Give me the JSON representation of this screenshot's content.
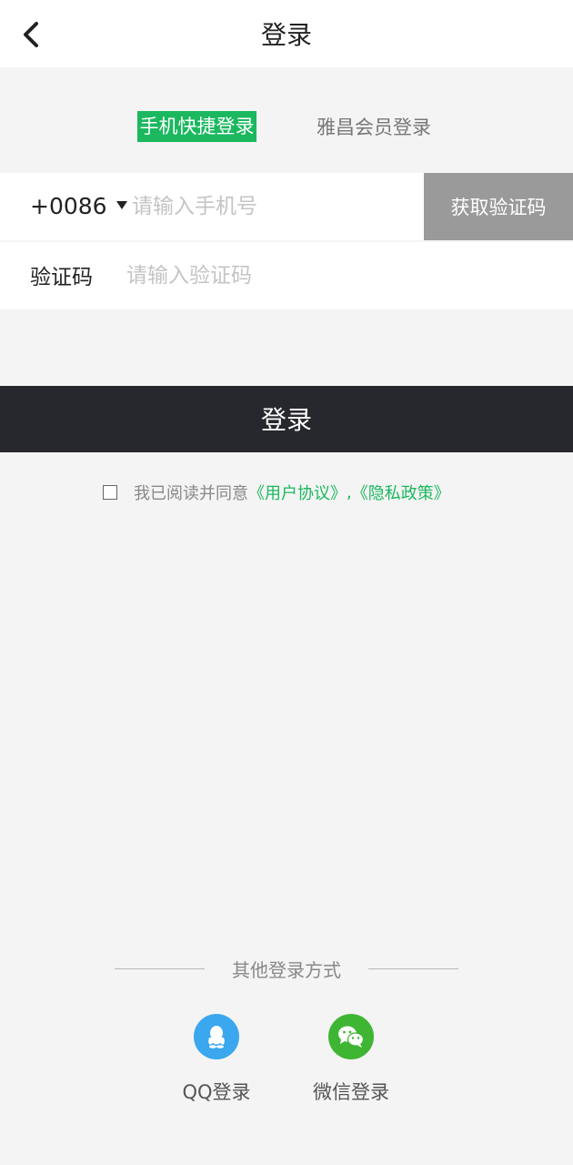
{
  "header": {
    "title": "登录"
  },
  "tabs": {
    "active": "手机快捷登录",
    "other": "雅昌会员登录"
  },
  "phone": {
    "country_code": "+0086",
    "placeholder": "请输入手机号",
    "get_code_label": "获取验证码"
  },
  "verify": {
    "label": "验证码",
    "placeholder": "请输入验证码"
  },
  "login_button": "登录",
  "agreement": {
    "prefix": "我已阅读并同意",
    "user_agreement": "《用户协议》",
    "separator": ",",
    "privacy_policy": "《隐私政策》"
  },
  "other_login": {
    "label": "其他登录方式",
    "qq_label": "QQ登录",
    "wechat_label": "微信登录"
  },
  "colors": {
    "accent_green": "#1bb85f",
    "login_button_bg": "#27282d",
    "get_code_bg": "#9a9a9a",
    "qq_blue": "#3aa7ee",
    "wechat_green": "#3fb534"
  }
}
